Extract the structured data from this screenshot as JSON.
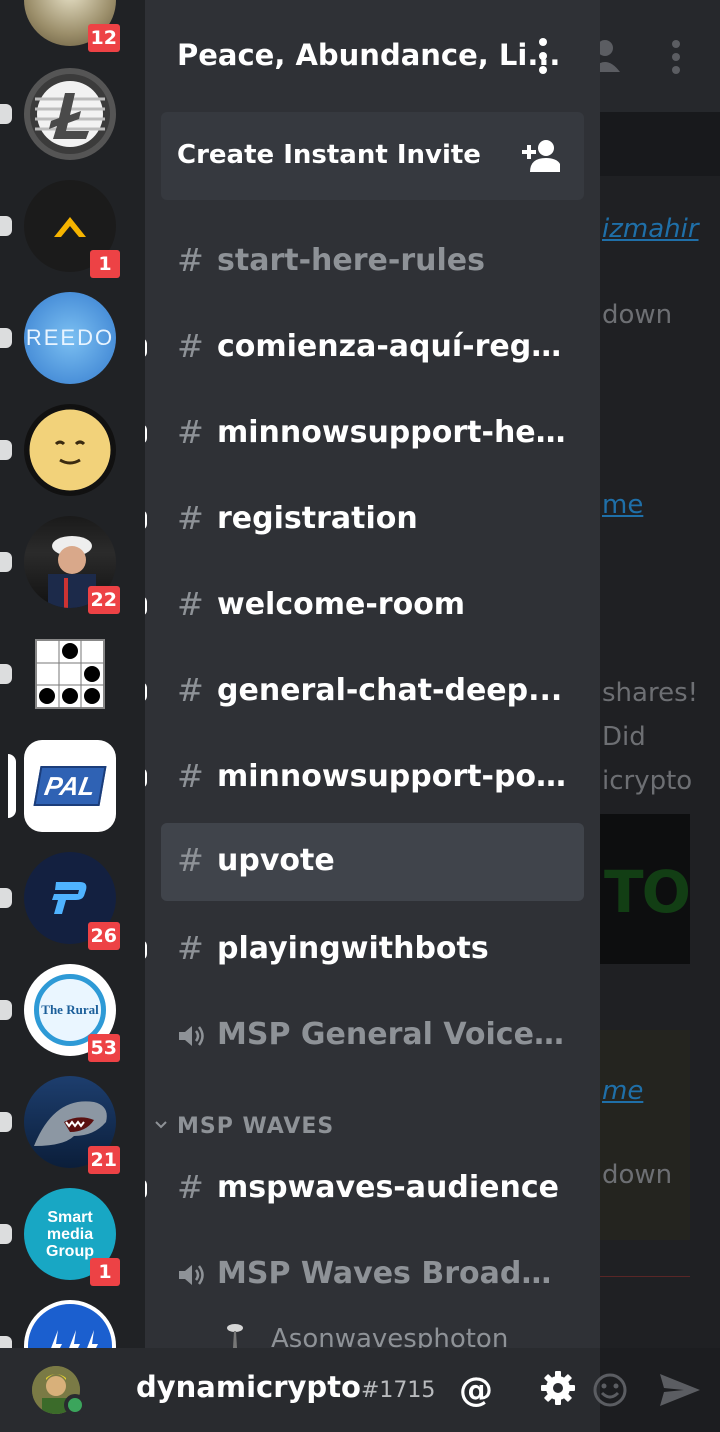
{
  "guild": {
    "name": "Peace, Abundance, Li...",
    "invite_label": "Create Instant Invite"
  },
  "servers": [
    {
      "name": "server-1",
      "badge": "12"
    },
    {
      "name": "litecoin",
      "badge": ""
    },
    {
      "name": "server-3",
      "badge": "1"
    },
    {
      "name": "reedo",
      "badge": "",
      "avatar_text": "REEDO"
    },
    {
      "name": "server-5",
      "badge": ""
    },
    {
      "name": "server-6",
      "badge": "22"
    },
    {
      "name": "server-7",
      "badge": ""
    },
    {
      "name": "pal",
      "badge": "",
      "avatar_text": "PAL",
      "active": true
    },
    {
      "name": "server-9",
      "badge": "26"
    },
    {
      "name": "the-rural",
      "badge": "53",
      "avatar_text": "The Rural"
    },
    {
      "name": "server-11",
      "badge": "21"
    },
    {
      "name": "smart-media-group",
      "badge": "1",
      "avatar_text": "Smart media Group"
    },
    {
      "name": "server-13",
      "badge": ""
    }
  ],
  "channels": [
    {
      "type": "text",
      "name": "start-here-rules",
      "unread": false,
      "muted": true
    },
    {
      "type": "text",
      "name": "comienza-aquí-regl...",
      "unread": true,
      "muted": false
    },
    {
      "type": "text",
      "name": "minnowsupport-help",
      "unread": true,
      "muted": false
    },
    {
      "type": "text",
      "name": "registration",
      "unread": true,
      "muted": false
    },
    {
      "type": "text",
      "name": "welcome-room",
      "unread": true,
      "muted": false
    },
    {
      "type": "text",
      "name": "general-chat-deep...",
      "unread": true,
      "muted": false
    },
    {
      "type": "text",
      "name": "minnowsupport-po...",
      "unread": true,
      "muted": false
    },
    {
      "type": "text",
      "name": "upvote",
      "unread": false,
      "muted": false,
      "selected": true
    },
    {
      "type": "text",
      "name": "playingwithbots",
      "unread": true,
      "muted": false
    },
    {
      "type": "voice",
      "name": "MSP General Voice-P...",
      "unread": false,
      "muted": true
    }
  ],
  "category": {
    "label": "MSP WAVES",
    "channels": [
      {
        "type": "text",
        "name": "mspwaves-audience",
        "unread": true,
        "muted": false
      },
      {
        "type": "voice",
        "name": "MSP Waves Broadcast",
        "unread": false,
        "muted": true
      }
    ],
    "voice_user": "Asonwavesphoton"
  },
  "chat_peek": {
    "lines": [
      {
        "text": "izmahir",
        "kind": "link"
      },
      {
        "text": "down",
        "kind": "text"
      },
      {
        "text": "me",
        "kind": "link-plain"
      },
      {
        "text": "shares!",
        "kind": "text"
      },
      {
        "text": "Did",
        "kind": "text"
      },
      {
        "text": "icrypto",
        "kind": "text"
      },
      {
        "text": "me",
        "kind": "link"
      },
      {
        "text": "down",
        "kind": "text"
      }
    ],
    "image_text": "TO"
  },
  "user": {
    "name": "dynamicrypto",
    "tag": "#1715",
    "status": "online",
    "mention_label": "@"
  },
  "colors": {
    "rail": "#202225",
    "sidebar": "#2f3136",
    "selected": "#40444b",
    "badge": "#ed4245",
    "online": "#3ba55c"
  }
}
